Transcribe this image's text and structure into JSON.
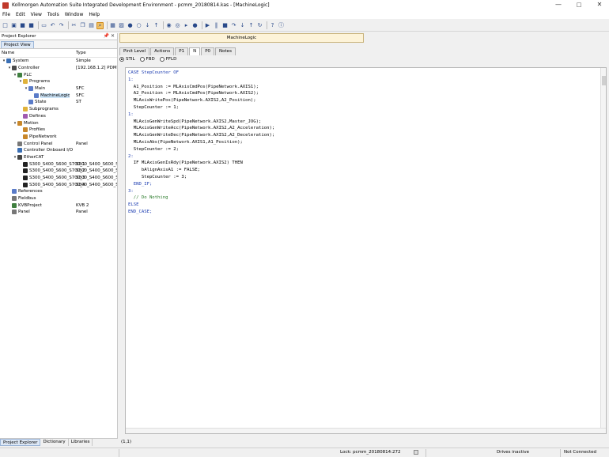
{
  "window": {
    "title": "Kollmorgen Automation Suite Integrated Development Environment - pcmm_20180814.kas - [MachineLogic]",
    "controls": {
      "minimize": "—",
      "maximize": "□",
      "close": "✕"
    }
  },
  "menu": [
    {
      "label": "File"
    },
    {
      "label": "Edit"
    },
    {
      "label": "View"
    },
    {
      "label": "Tools"
    },
    {
      "label": "Window"
    },
    {
      "label": "Help"
    }
  ],
  "toolbar": {
    "icons": [
      "new-icon",
      "open-icon",
      "save-icon",
      "save-all-icon",
      "print-icon",
      "undo-icon",
      "redo-icon",
      "cut-icon",
      "copy-icon",
      "paste-icon",
      "find-icon",
      "build-icon",
      "compile-icon",
      "connect-icon",
      "disconnect-icon",
      "download-icon",
      "upload-icon",
      "monitor-icon",
      "watch-icon",
      "step-icon",
      "breakpoint-icon",
      "run-icon",
      "pause-icon",
      "stop-icon",
      "step-over-icon",
      "step-into-icon",
      "step-out-icon",
      "refresh-icon",
      "help-icon",
      "about-icon"
    ]
  },
  "project_explorer": {
    "header": "Project Explorer",
    "header_icons": "📌 ✕",
    "tab": "Project View",
    "columns": {
      "name": "Name",
      "type": "Type"
    },
    "rows": [
      {
        "indent": 0,
        "toggle": "▾",
        "icon_color": "#3a6fb5",
        "label": "System",
        "type": "Simple",
        "selected": false
      },
      {
        "indent": 1,
        "toggle": "▾",
        "icon_color": "#4a4a4a",
        "label": "Controller",
        "type": "[192.168.1.2] PDMM e...",
        "selected": false
      },
      {
        "indent": 2,
        "toggle": "▾",
        "icon_color": "#3f7f3f",
        "label": "PLC",
        "type": "",
        "selected": false
      },
      {
        "indent": 3,
        "toggle": "▾",
        "icon_color": "#e0b23a",
        "label": "Programs",
        "type": "",
        "selected": false
      },
      {
        "indent": 4,
        "toggle": "▾",
        "icon_color": "#5a7bc8",
        "label": "Main",
        "type": "SFC",
        "selected": false
      },
      {
        "indent": 5,
        "toggle": "",
        "icon_color": "#5a7bc8",
        "label": "MachineLogic",
        "type": "SFC",
        "selected": true
      },
      {
        "indent": 4,
        "toggle": "",
        "icon_color": "#5a7bc8",
        "label": "State",
        "type": "ST",
        "selected": false
      },
      {
        "indent": 3,
        "toggle": "",
        "icon_color": "#e0b23a",
        "label": "Subprograms",
        "type": "",
        "selected": false
      },
      {
        "indent": 3,
        "toggle": "",
        "icon_color": "#a05ab0",
        "label": "Defines",
        "type": "",
        "selected": false
      },
      {
        "indent": 2,
        "toggle": "▾",
        "icon_color": "#c8872a",
        "label": "Motion",
        "type": "",
        "selected": false
      },
      {
        "indent": 3,
        "toggle": "",
        "icon_color": "#c8872a",
        "label": "Profiles",
        "type": "",
        "selected": false
      },
      {
        "indent": 3,
        "toggle": "",
        "icon_color": "#c8872a",
        "label": "PipeNetwork",
        "type": "",
        "selected": false
      },
      {
        "indent": 2,
        "toggle": "",
        "icon_color": "#777777",
        "label": "Control Panel",
        "type": "Panel",
        "selected": false
      },
      {
        "indent": 2,
        "toggle": "",
        "icon_color": "#3a6fb5",
        "label": "Controller Onboard I/O",
        "type": "",
        "selected": false
      },
      {
        "indent": 2,
        "toggle": "▾",
        "icon_color": "#444444",
        "label": "EtherCAT",
        "type": "",
        "selected": false
      },
      {
        "indent": 3,
        "toggle": "",
        "icon_color": "#222222",
        "label": "S300_S400_S600_S700_1",
        "type": "S300_S400_S600_S700",
        "selected": false
      },
      {
        "indent": 3,
        "toggle": "",
        "icon_color": "#222222",
        "label": "S300_S400_S600_S700_2",
        "type": "S300_S400_S600_S700",
        "selected": false
      },
      {
        "indent": 3,
        "toggle": "",
        "icon_color": "#222222",
        "label": "S300_S400_S600_S700_3",
        "type": "S300_S400_S600_S700",
        "selected": false
      },
      {
        "indent": 3,
        "toggle": "",
        "icon_color": "#222222",
        "label": "S300_S400_S600_S700_4",
        "type": "S300_S400_S600_S700",
        "selected": false
      },
      {
        "indent": 1,
        "toggle": "",
        "icon_color": "#5a7bc8",
        "label": "References",
        "type": "",
        "selected": false
      },
      {
        "indent": 1,
        "toggle": "",
        "icon_color": "#777777",
        "label": "Fieldbus",
        "type": "",
        "selected": false
      },
      {
        "indent": 1,
        "toggle": "",
        "icon_color": "#3f7f3f",
        "label": "KVBProject",
        "type": "KVB 2",
        "selected": false
      },
      {
        "indent": 1,
        "toggle": "",
        "icon_color": "#777777",
        "label": "Panel",
        "type": "Panel",
        "selected": false
      }
    ],
    "bottom_tabs": [
      {
        "label": "Project Explorer",
        "active": true
      },
      {
        "label": "Dictionary",
        "active": false
      },
      {
        "label": "Libraries",
        "active": false
      }
    ]
  },
  "editor": {
    "document_tab": "MachineLogic",
    "sub_tabs": [
      {
        "label": "Pinit Level",
        "active": false
      },
      {
        "label": "Actions",
        "active": false
      },
      {
        "label": "P1",
        "active": false
      },
      {
        "label": "N",
        "active": true
      },
      {
        "label": "P0",
        "active": false
      },
      {
        "label": "Notes",
        "active": false
      }
    ],
    "languages": [
      {
        "label": "STIL",
        "checked": true
      },
      {
        "label": "FBD",
        "checked": false
      },
      {
        "label": "FFLD",
        "checked": false
      }
    ],
    "code_lines": [
      "CASE StepCounter OF",
      "",
      "1:",
      "  A1_Position := MLAxisCmdPos(PipeNetwork.AXIS1);",
      "  A2_Position := MLAxisCmdPos(PipeNetwork.AXIS2);",
      "  MLAxisWritePos(PipeNetwork.AXIS2,A2_Position);",
      "  StepCounter := 1;",
      "",
      "1:",
      "  MLAxisGenWriteSpd(PipeNetwork.AXIS2,Master_JOG);",
      "  MLAxisGenWriteAcc(PipeNetwork.AXIS2,A2_Acceleration);",
      "  MLAxisGenWriteDec(PipeNetwork.AXIS2,A2_Deceleration);",
      "  MLAxisAbs(PipeNetwork.AXIS1,A1_Position);",
      "  StepCounter := 2;",
      "",
      "2:",
      "  IF MLAxisGenIsRdy(PipeNetwork.AXIS2) THEN",
      "     bAlignAxisA1 := FALSE;",
      "     StepCounter := 3;",
      "  END_IF;",
      "",
      "3:",
      "  // Do Nothing",
      "",
      "ELSE",
      "",
      "END_CASE;"
    ],
    "cursor_position": "(1,1)"
  },
  "status_bar": {
    "lock": "Lock: pcmm_20180814:272",
    "drives": "Drives inactive",
    "connection": "Not Connected"
  }
}
